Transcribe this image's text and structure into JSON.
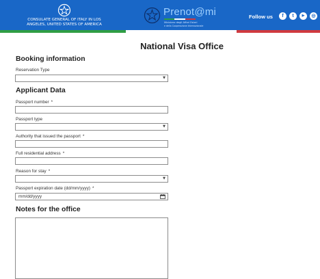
{
  "header": {
    "consulate_name": "CONSULATE GENERAL OF ITALY IN LOS ANGELES, UNITED STATES OF AMERICA",
    "brand": "Prenot@mi",
    "brand_sub_1": "Ministero degli Affari Esteri",
    "brand_sub_2": "e della Cooperazione Internazionale",
    "follow_label": "Follow us",
    "social": [
      {
        "icon": "facebook-icon",
        "glyph": "f"
      },
      {
        "icon": "twitter-icon",
        "glyph": "t"
      },
      {
        "icon": "youtube-icon",
        "glyph": "▶"
      },
      {
        "icon": "instagram-icon",
        "glyph": "◎"
      }
    ],
    "colors": {
      "header_bg": "#1967c7",
      "green": "#2f9e44",
      "white": "#ffffff",
      "red": "#d03a3f"
    }
  },
  "page": {
    "title": "National Visa Office"
  },
  "booking": {
    "heading": "Booking information",
    "reservation_type_label": "Reservation Type",
    "reservation_type_value": ""
  },
  "applicant": {
    "heading": "Applicant Data",
    "passport_number_label": "Passport number",
    "passport_type_label": "Passport type",
    "authority_label": "Authority that issued the passport",
    "address_label": "Full residential address",
    "reason_label": "Reason for stay",
    "expiration_label": "Passport expiration date (dd/mm/yyyy)",
    "expiration_placeholder": "mm/dd/yyyy",
    "required_mark": "*"
  },
  "notes": {
    "heading": "Notes for the office"
  }
}
